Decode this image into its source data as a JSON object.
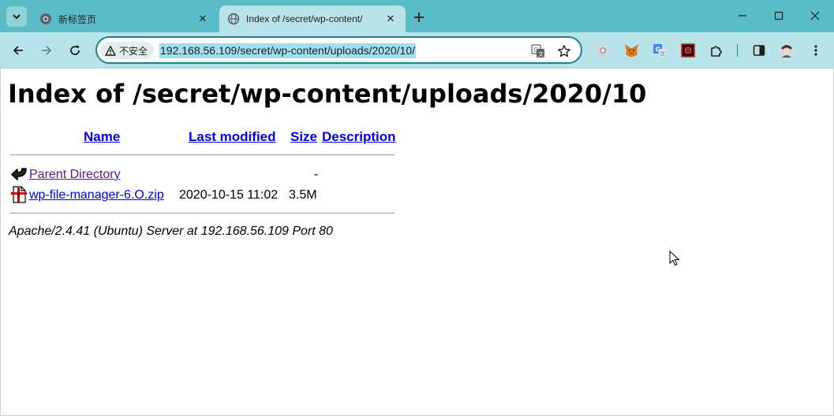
{
  "browser": {
    "tabs": [
      {
        "title": "新标签页",
        "favicon": "chrome-icon",
        "active": false
      },
      {
        "title": "Index of /secret/wp-content/",
        "favicon": "globe-icon",
        "active": true
      }
    ],
    "security_chip": "不安全",
    "url": "192.168.56.109/secret/wp-content/uploads/2020/10/",
    "extensions": [
      "circle-extension-icon",
      "metamask-fox-icon",
      "google-translate-icon",
      "red-box-extension-icon",
      "puzzle-extensions-icon"
    ]
  },
  "page": {
    "heading": "Index of /secret/wp-content/uploads/2020/10",
    "columns": {
      "name": "Name",
      "last_modified": "Last modified",
      "size": "Size",
      "description": "Description"
    },
    "rows": [
      {
        "name": "Parent Directory",
        "last_modified": "",
        "size": "-",
        "description": "",
        "icon": "back-arrow-icon",
        "visited": true
      },
      {
        "name": "wp-file-manager-6.O.zip",
        "last_modified": "2020-10-15 11:02",
        "size": "3.5M",
        "description": "",
        "icon": "zip-file-icon",
        "visited": false
      }
    ],
    "address": "Apache/2.4.41 (Ubuntu) Server at 192.168.56.109 Port 80"
  },
  "colors": {
    "tabstrip": "#5bbcc7",
    "toolbar": "#b8e3e8",
    "link": "#0000ee",
    "visited": "#551a8b"
  }
}
